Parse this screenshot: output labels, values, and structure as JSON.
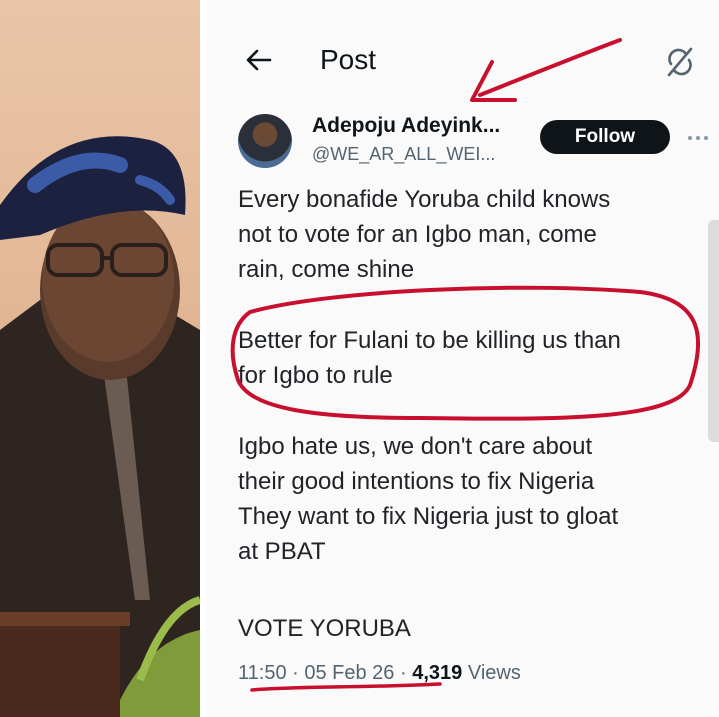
{
  "header": {
    "title": "Post",
    "back_icon": "back-arrow-icon",
    "right_icon": "sync-icon"
  },
  "author": {
    "name": "Adepoju Adeyink...",
    "handle": "@WE_AR_ALL_WEI...",
    "follow_label": "Follow"
  },
  "post": {
    "paragraphs": [
      [
        "Every bonafide Yoruba child knows",
        "not to vote for an Igbo man, come",
        "rain, come shine"
      ],
      [
        "Better for Fulani to be killing us than",
        "for Igbo to rule"
      ],
      [
        "Igbo hate us, we don't care about",
        "their good intentions to fix Nigeria",
        "They want to fix Nigeria just to gloat",
        "at PBAT"
      ],
      [
        "VOTE YORUBA"
      ]
    ]
  },
  "meta": {
    "time": "11:50",
    "sep": " · ",
    "date": "05 Feb 26",
    "views_count": "4,319",
    "views_label": " Views"
  },
  "colors": {
    "annotation_red": "#c8102e",
    "follow_bg": "#0f1419",
    "text": "#202327",
    "muted": "#536471"
  }
}
